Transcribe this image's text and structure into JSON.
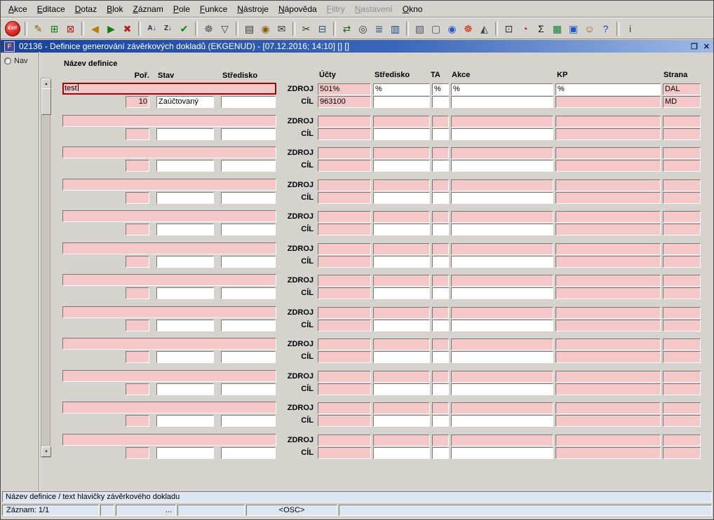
{
  "colors": {
    "chrome": "#d6d3ce",
    "field_pink": "#f4c8c8",
    "focus_red": "#a40000",
    "titlebar_start": "#17429a",
    "titlebar_end": "#9db9e4",
    "status_bg": "#dbe6f2"
  },
  "menu": {
    "items": [
      {
        "name": "menu-akce",
        "label": "Akce",
        "enabled": true
      },
      {
        "name": "menu-editace",
        "label": "Editace",
        "enabled": true
      },
      {
        "name": "menu-dotaz",
        "label": "Dotaz",
        "enabled": true
      },
      {
        "name": "menu-blok",
        "label": "Blok",
        "enabled": true
      },
      {
        "name": "menu-zaznam",
        "label": "Záznam",
        "enabled": true
      },
      {
        "name": "menu-pole",
        "label": "Pole",
        "enabled": true
      },
      {
        "name": "menu-funkce",
        "label": "Funkce",
        "enabled": true
      },
      {
        "name": "menu-nastroje",
        "label": "Nástroje",
        "enabled": true
      },
      {
        "name": "menu-napoveda",
        "label": "Nápověda",
        "enabled": true
      },
      {
        "name": "menu-filtry",
        "label": "Filtry",
        "enabled": false
      },
      {
        "name": "menu-nastaveni",
        "label": "Nastavení",
        "enabled": false
      },
      {
        "name": "menu-okno",
        "label": "Okno",
        "enabled": true
      }
    ]
  },
  "toolbar": {
    "items": [
      {
        "name": "exit-button",
        "glyph": "EXIT",
        "kind": "exit"
      },
      {
        "kind": "sep"
      },
      {
        "name": "edit-record-icon",
        "glyph": "✎",
        "color": "#7a6a10"
      },
      {
        "name": "insert-record-icon",
        "glyph": "⊞",
        "color": "#157a15"
      },
      {
        "name": "delete-record-icon",
        "glyph": "⊠",
        "color": "#b51f1f"
      },
      {
        "kind": "sep"
      },
      {
        "name": "enter-query-icon",
        "glyph": "◀",
        "color": "#b08000"
      },
      {
        "name": "execute-query-icon",
        "glyph": "▶",
        "color": "#157a15"
      },
      {
        "name": "cancel-query-icon",
        "glyph": "✖",
        "color": "#b51f1f"
      },
      {
        "kind": "sep"
      },
      {
        "name": "sort-ascending-icon",
        "glyph": "A↓",
        "color": "#203040",
        "small": true
      },
      {
        "name": "sort-descending-icon",
        "glyph": "Z↓",
        "color": "#203040",
        "small": true
      },
      {
        "name": "commit-icon",
        "glyph": "✔",
        "color": "#157a15"
      },
      {
        "kind": "sep"
      },
      {
        "name": "tools-icon",
        "glyph": "☸",
        "color": "#555555"
      },
      {
        "name": "filter-icon",
        "glyph": "▽",
        "color": "#404040"
      },
      {
        "kind": "sep"
      },
      {
        "name": "print-icon",
        "glyph": "▤",
        "color": "#333333"
      },
      {
        "name": "stamp-icon",
        "glyph": "◉",
        "color": "#8a5a10"
      },
      {
        "name": "mail-icon",
        "glyph": "✉",
        "color": "#333333"
      },
      {
        "kind": "sep"
      },
      {
        "name": "cut-icon",
        "glyph": "✂",
        "color": "#333333"
      },
      {
        "name": "paste-icon",
        "glyph": "⊟",
        "color": "#335577"
      },
      {
        "kind": "sep"
      },
      {
        "name": "transfer-icon",
        "glyph": "⇄",
        "color": "#206020"
      },
      {
        "name": "preview-icon",
        "glyph": "◎",
        "color": "#333333"
      },
      {
        "name": "list-icon",
        "glyph": "≣",
        "color": "#204a8a"
      },
      {
        "name": "columns-icon",
        "glyph": "▥",
        "color": "#204a8a"
      },
      {
        "kind": "sep"
      },
      {
        "name": "clipboard-icon",
        "glyph": "▧",
        "color": "#555566"
      },
      {
        "name": "document-icon",
        "glyph": "▢",
        "color": "#555555"
      },
      {
        "name": "globe-icon",
        "glyph": "◉",
        "color": "#2255cc"
      },
      {
        "name": "gear-icon",
        "glyph": "☸",
        "color": "#cc2200"
      },
      {
        "name": "mountain-icon",
        "glyph": "◭",
        "color": "#334455"
      },
      {
        "kind": "sep"
      },
      {
        "name": "window-export-icon",
        "glyph": "⊡",
        "color": "#333333"
      },
      {
        "name": "gauge-icon",
        "glyph": "◔",
        "color": "#aa2222"
      },
      {
        "name": "sum-icon",
        "glyph": "Σ",
        "color": "#111111"
      },
      {
        "name": "spreadsheet-icon",
        "glyph": "▦",
        "color": "#157a3a"
      },
      {
        "name": "book-icon",
        "glyph": "▣",
        "color": "#2255cc"
      },
      {
        "name": "assistant-icon",
        "glyph": "☺",
        "color": "#8a5a10"
      },
      {
        "name": "help-icon",
        "glyph": "?",
        "color": "#2244aa"
      },
      {
        "kind": "sep"
      },
      {
        "name": "info-icon",
        "glyph": "i",
        "color": "#444444"
      }
    ]
  },
  "window": {
    "title": "02136 - Definice generování závěrkových dokladů (EKGENUD) - [07.12.2016; 14:10]  []  []",
    "icon_letter": "F",
    "restore_glyph": "❐",
    "close_glyph": "✕"
  },
  "nav": {
    "label": "Nav"
  },
  "scrollbar": {
    "up": "▲",
    "down": "▼"
  },
  "form": {
    "section_label": "Název definice",
    "headers": {
      "por": "Poř.",
      "stav": "Stav",
      "stredisko": "Středisko",
      "ucty": "Účty",
      "stredisko2": "Středisko",
      "ta": "TA",
      "akce": "Akce",
      "kp": "KP",
      "strana": "Strana"
    },
    "row_labels": {
      "zdroj": "ZDROJ",
      "cil": "CÍL"
    },
    "field_colors": {
      "zdroj_filled": [
        "pink",
        "white",
        "white",
        "white",
        "white",
        "pink"
      ],
      "zdroj_empty": [
        "pink",
        "pink",
        "pink",
        "pink",
        "pink",
        "pink"
      ],
      "cil": [
        "pink",
        "white",
        "white",
        "white",
        "pink",
        "pink"
      ]
    },
    "groups": [
      {
        "nazev": "test",
        "focused": true,
        "por": "10",
        "stav": "Zaúčtovaný",
        "stredisko": "",
        "zdroj": {
          "ucty": "501%",
          "stredisko": "%",
          "ta": "%",
          "akce": "%",
          "kp": "%",
          "strana": "DAL"
        },
        "cil": {
          "ucty": "963100",
          "stredisko": "",
          "ta": "",
          "akce": "",
          "kp": "",
          "strana": "MD"
        }
      },
      {},
      {},
      {},
      {},
      {},
      {},
      {},
      {},
      {},
      {},
      {}
    ]
  },
  "statusbar": {
    "hint": "Název definice / text hlavičky závěrkového dokladu"
  },
  "recordbar": {
    "cells": [
      "Záznam: 1/1",
      "",
      "...",
      "",
      "<OSC>",
      ""
    ]
  }
}
